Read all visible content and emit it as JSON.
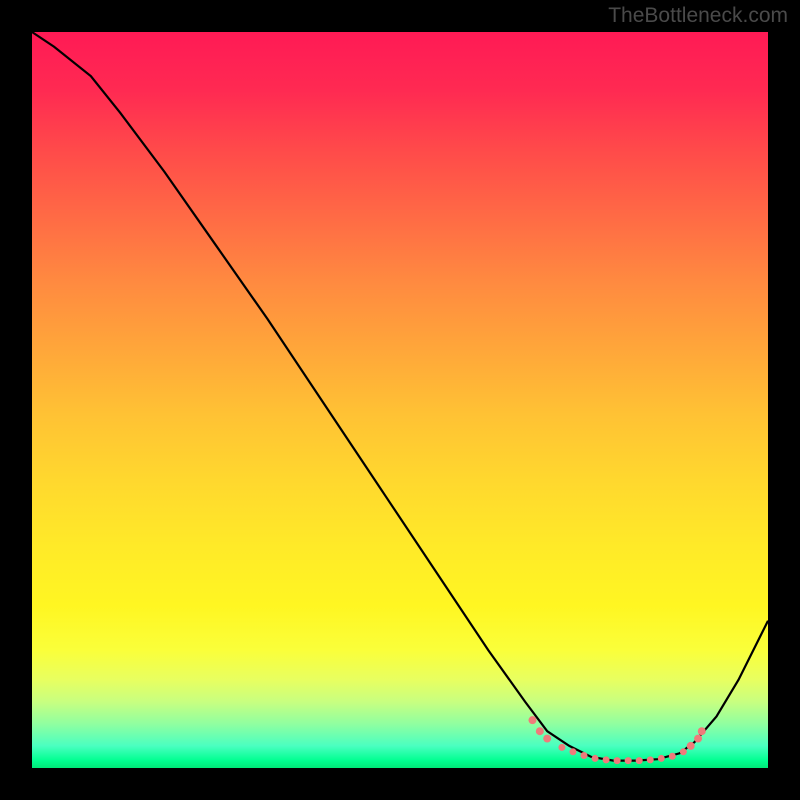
{
  "watermark": "TheBottleneck.com",
  "chart_data": {
    "type": "line",
    "title": "",
    "xlabel": "",
    "ylabel": "",
    "xlim": [
      0,
      100
    ],
    "ylim": [
      0,
      100
    ],
    "series": [
      {
        "name": "curve",
        "x": [
          0,
          3,
          8,
          12,
          18,
          25,
          32,
          40,
          48,
          56,
          62,
          67,
          70,
          73,
          76,
          79,
          82,
          85,
          88,
          90,
          93,
          96,
          100
        ],
        "y": [
          100,
          98,
          94,
          89,
          81,
          71,
          61,
          49,
          37,
          25,
          16,
          9,
          5,
          3,
          1.5,
          1,
          1,
          1.2,
          2,
          3.5,
          7,
          12,
          20
        ]
      }
    ],
    "markers": {
      "name": "highlight-cluster",
      "color": "#ef7b7b",
      "points": [
        {
          "x": 68,
          "y": 6.5,
          "r": 4
        },
        {
          "x": 69,
          "y": 5.0,
          "r": 4
        },
        {
          "x": 70,
          "y": 4.0,
          "r": 4
        },
        {
          "x": 72,
          "y": 2.8,
          "r": 3.5
        },
        {
          "x": 73.5,
          "y": 2.2,
          "r": 3.5
        },
        {
          "x": 75,
          "y": 1.7,
          "r": 3.5
        },
        {
          "x": 76.5,
          "y": 1.3,
          "r": 3.5
        },
        {
          "x": 78,
          "y": 1.1,
          "r": 3.5
        },
        {
          "x": 79.5,
          "y": 1.0,
          "r": 3.5
        },
        {
          "x": 81,
          "y": 1.0,
          "r": 3.5
        },
        {
          "x": 82.5,
          "y": 1.0,
          "r": 3.5
        },
        {
          "x": 84,
          "y": 1.1,
          "r": 3.5
        },
        {
          "x": 85.5,
          "y": 1.3,
          "r": 3.5
        },
        {
          "x": 87,
          "y": 1.6,
          "r": 3.5
        },
        {
          "x": 88.5,
          "y": 2.2,
          "r": 3.5
        },
        {
          "x": 89.5,
          "y": 3.0,
          "r": 4
        },
        {
          "x": 90.5,
          "y": 4.0,
          "r": 4
        },
        {
          "x": 91,
          "y": 5.0,
          "r": 4
        }
      ]
    }
  }
}
